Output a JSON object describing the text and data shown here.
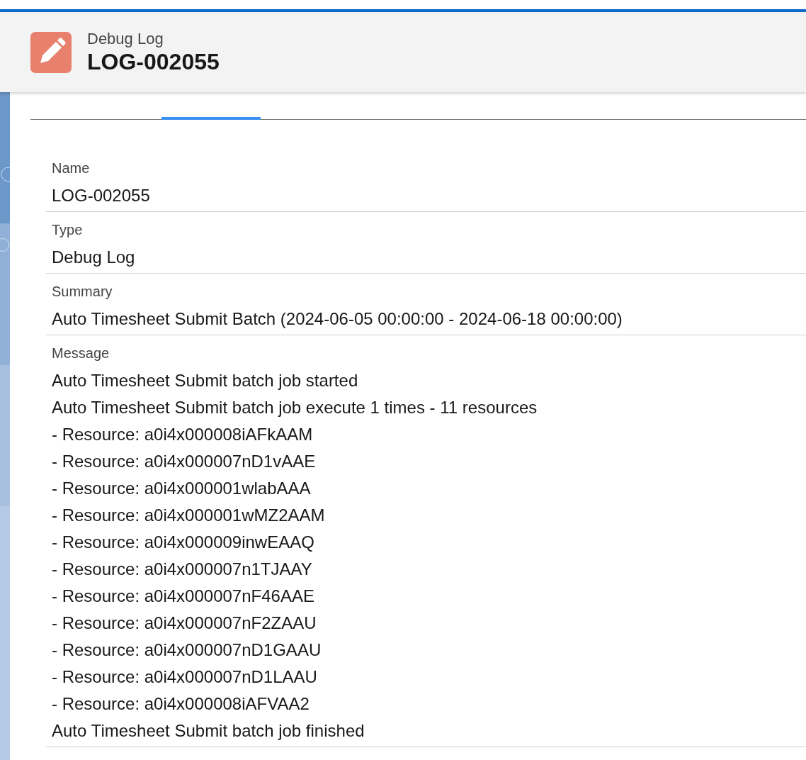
{
  "header": {
    "object_type": "Debug Log",
    "title": "LOG-002055"
  },
  "tabs": [
    {
      "selected": false
    },
    {
      "selected": true
    }
  ],
  "fields": [
    {
      "label": "Name",
      "lines": [
        "LOG-002055"
      ]
    },
    {
      "label": "Type",
      "lines": [
        "Debug Log"
      ]
    },
    {
      "label": "Summary",
      "lines": [
        "Auto Timesheet Submit Batch (2024-06-05 00:00:00 - 2024-06-18 00:00:00)"
      ]
    },
    {
      "label": "Message",
      "lines": [
        "Auto Timesheet Submit batch job started",
        "Auto Timesheet Submit batch job execute 1 times - 11 resources",
        "- Resource: a0i4x000008iAFkAAM",
        "- Resource: a0i4x000007nD1vAAE",
        "- Resource: a0i4x000001wlabAAA",
        "- Resource: a0i4x000001wMZ2AAM",
        "- Resource: a0i4x000009inwEAAQ",
        "- Resource: a0i4x000007n1TJAAY",
        "- Resource: a0i4x000007nF46AAE",
        "- Resource: a0i4x000007nF2ZAAU",
        "- Resource: a0i4x000007nD1GAAU",
        "- Resource: a0i4x000007nD1LAAU",
        "- Resource: a0i4x000008iAFVAA2",
        "Auto Timesheet Submit batch job finished"
      ]
    }
  ]
}
